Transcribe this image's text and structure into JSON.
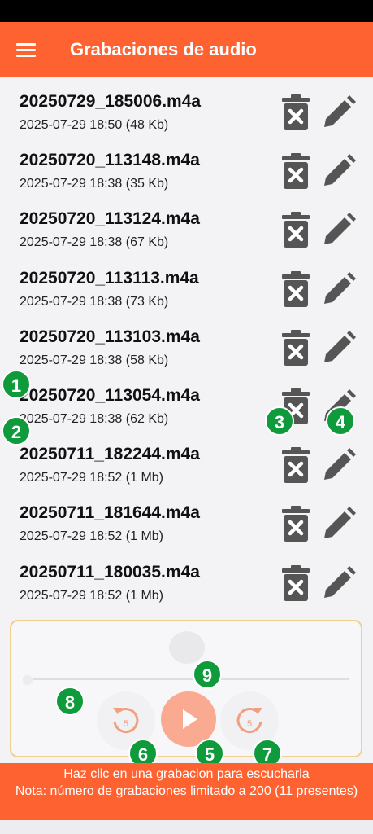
{
  "app_bar": {
    "title": "Grabaciones de audio",
    "menu_icon": "hamburger-menu-icon",
    "color": "#ff6231"
  },
  "recordings": [
    {
      "name": "20250729_185006.m4a",
      "meta": "2025-07-29 18:50 (48 Kb)"
    },
    {
      "name": "20250720_113148.m4a",
      "meta": "2025-07-29 18:38 (35 Kb)"
    },
    {
      "name": "20250720_113124.m4a",
      "meta": "2025-07-29 18:38 (67 Kb)"
    },
    {
      "name": "20250720_113113.m4a",
      "meta": "2025-07-29 18:38 (73 Kb)"
    },
    {
      "name": "20250720_113103.m4a",
      "meta": "2025-07-29 18:38 (58 Kb)"
    },
    {
      "name": "20250720_113054.m4a",
      "meta": "2025-07-29 18:38 (62 Kb)"
    },
    {
      "name": "20250711_182244.m4a",
      "meta": "2025-07-29 18:52 (1 Mb)"
    },
    {
      "name": "20250711_181644.m4a",
      "meta": "2025-07-29 18:52 (1 Mb)"
    },
    {
      "name": "20250711_180035.m4a",
      "meta": "2025-07-29 18:52 (1 Mb)"
    }
  ],
  "row_icons": {
    "delete": "trash-x-icon",
    "edit": "pencil-icon"
  },
  "player": {
    "rewind_label": "5",
    "forward_label": "5",
    "progress": 0,
    "icons": {
      "rewind": "replay-5-icon",
      "play": "play-icon",
      "forward": "forward-5-icon"
    }
  },
  "annotations": [
    "1",
    "2",
    "3",
    "4",
    "5",
    "6",
    "7",
    "8",
    "9"
  ],
  "footer": {
    "line1": "Haz clic en una grabacion para escucharla",
    "line2": "Nota: número de grabaciones limitado a 200 (11 presentes)"
  }
}
